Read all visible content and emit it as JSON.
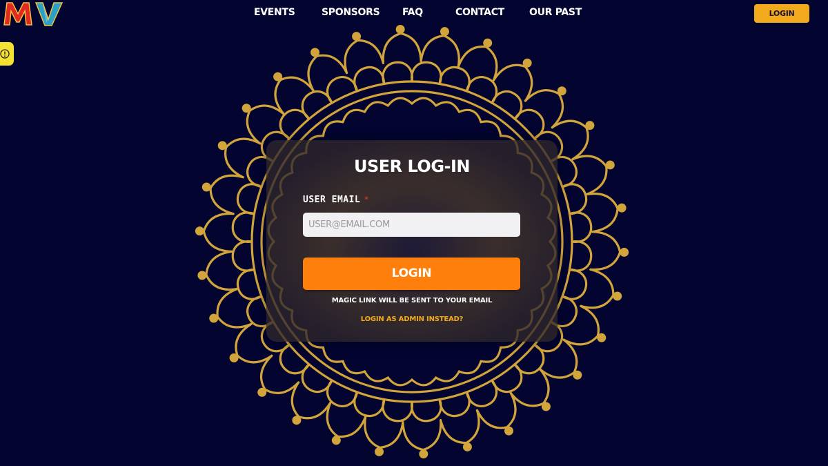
{
  "header": {
    "logo_text": "MV",
    "nav": [
      {
        "label": "EVENTS"
      },
      {
        "label": "SPONSORS"
      },
      {
        "label": "FAQ"
      },
      {
        "label": "CONTACT"
      },
      {
        "label": "OUR PAST"
      }
    ],
    "login_label": "LOGIN"
  },
  "side_tab": {
    "icon": "info-icon"
  },
  "login_card": {
    "title": "USER LOG-IN",
    "email_label": "USER EMAIL",
    "required_mark": "*",
    "email_placeholder": "USER@EMAIL.COM",
    "email_value": "",
    "login_button": "LOGIN",
    "magic_note": "MAGIC LINK WILL BE SENT TO YOUR EMAIL",
    "admin_link": "LOGIN AS ADMIN INSTEAD?"
  },
  "colors": {
    "background": "#030430",
    "mandala_gold": "#d2a43c",
    "accent_orange": "#fe7f0c",
    "header_button": "#f2a91c",
    "side_tab": "#f6e032"
  }
}
